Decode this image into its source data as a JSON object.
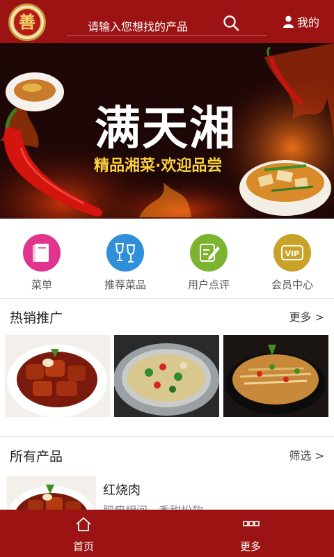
{
  "header": {
    "logo_glyph": "善",
    "search_placeholder": "请输入您想找的产品",
    "user_label": "我的"
  },
  "banner": {
    "title": "满天湘",
    "subtitle": "精品湘菜·欢迎品尝",
    "slide_count": 2,
    "active_slide": 1
  },
  "quick_nav": [
    {
      "label": "菜单",
      "icon": "book-icon",
      "color": "#e0348f"
    },
    {
      "label": "推荐菜品",
      "icon": "wine-glasses-icon",
      "color": "#2f8fd8"
    },
    {
      "label": "用户点评",
      "icon": "edit-note-icon",
      "color": "#7cb430"
    },
    {
      "label": "会员中心",
      "icon": "vip-icon",
      "color": "#c9a328"
    }
  ],
  "hot": {
    "title": "热销推广",
    "more": "更多 >",
    "items": [
      {
        "name": "braised-pork-photo"
      },
      {
        "name": "stir-fried-dish-photo"
      },
      {
        "name": "sizzling-plate-photo"
      }
    ]
  },
  "all": {
    "title": "所有产品",
    "filter": "筛选 >",
    "products": [
      {
        "name": "红烧肉",
        "desc": "肥瘦相间，香甜松软"
      }
    ]
  },
  "bottom_nav": [
    {
      "label": "首页",
      "icon": "home-icon"
    },
    {
      "label": "更多",
      "icon": "more-icon"
    }
  ],
  "colors": {
    "brand": "#9b1313",
    "accent_gold": "#ffd23c"
  }
}
